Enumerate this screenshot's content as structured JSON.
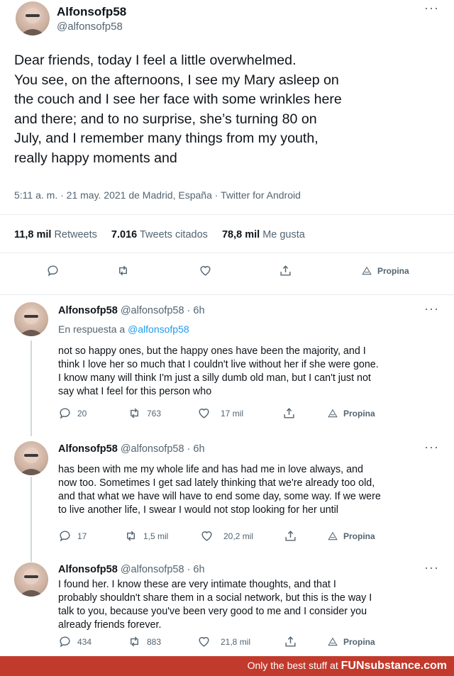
{
  "main_tweet": {
    "display_name": "Alfonsofp58",
    "handle": "@alfonsofp58",
    "lines": [
      "Dear friends, today I feel a little overwhelmed.",
      "You see, on the afternoons, I see my Mary asleep on",
      "the couch and I see her face with some wrinkles here",
      "and there; and to no surprise, she’s turning 80 on",
      "July, and I remember many things from my youth,",
      "really happy moments and"
    ],
    "meta": "5:11 a. m. · 21 may. 2021 de Madrid, España · Twitter for Android",
    "stats": {
      "retweets_count": "11,8 mil",
      "retweets_label": "Retweets",
      "quotes_count": "7.016",
      "quotes_label": "Tweets citados",
      "likes_count": "78,8 mil",
      "likes_label": "Me gusta"
    },
    "tip_label": "Propina"
  },
  "replies": [
    {
      "display_name": "Alfonsofp58",
      "handle_time": "@alfonsofp58 · 6h",
      "reply_prefix": "En respuesta a",
      "reply_to": "@alfonsofp58",
      "lines": [
        "not so happy ones, but the happy ones have been the majority, and I",
        "think I love her so much that I couldn't live without her if she were gone.",
        "I know many will think I'm just a silly dumb old man, but I can't just not",
        "say what I feel for this person who"
      ],
      "replies_count": "20",
      "retweets_count": "763",
      "likes_count": "17 mil",
      "tip_label": "Propina"
    },
    {
      "display_name": "Alfonsofp58",
      "handle_time": "@alfonsofp58 · 6h",
      "lines": [
        "has been with me my whole life and has had me in love always, and",
        "now too. Sometimes I get sad lately thinking that we're already too old,",
        "and that what we have will have to end some day, some way. If we were",
        "to live another life, I swear I would not stop looking for her until"
      ],
      "replies_count": "17",
      "retweets_count": "1,5 mil",
      "likes_count": "20,2 mil",
      "tip_label": "Propina"
    },
    {
      "display_name": "Alfonsofp58",
      "handle_time": "@alfonsofp58 · 6h",
      "lines": [
        "I found her. I know these are very intimate thoughts, and that I",
        "probably shouldn't share them in a social network, but this is the way I",
        "talk to you, because you've been very good to me and I consider you",
        "already friends forever."
      ],
      "replies_count": "434",
      "retweets_count": "883",
      "likes_count": "21,8 mil",
      "tip_label": "Propina"
    }
  ],
  "footer": {
    "tagline": "Only the best stuff at",
    "brand": "FUNsubstance.com"
  },
  "icons": {
    "more": "more-options-icon",
    "reply": "reply-icon",
    "retweet": "retweet-icon",
    "like": "like-icon",
    "share": "share-icon",
    "tip": "tip-icon"
  },
  "colors": {
    "link": "#1d9bf0",
    "muted": "#536471",
    "footer_bg": "#c23a2c"
  }
}
